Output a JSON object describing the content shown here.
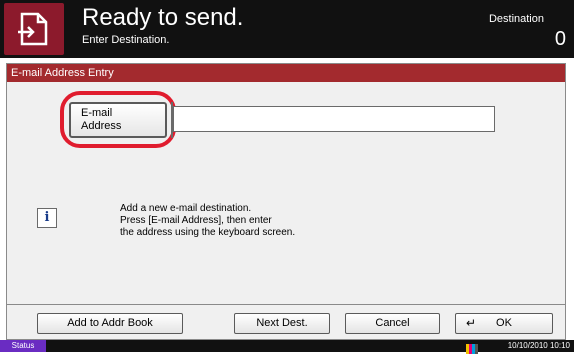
{
  "header": {
    "title": "Ready to send.",
    "subtitle": "Enter Destination.",
    "destination_label": "Destination",
    "destination_count": "0",
    "icon": "send-document-icon"
  },
  "panel": {
    "title": "E-mail Address Entry",
    "email_button_line1": "E-mail",
    "email_button_line2": "Address",
    "address_value": "",
    "info_icon": "info-icon",
    "info_lines": [
      "Add a new e-mail destination.",
      "Press [E-mail Address], then enter",
      "the address using the keyboard screen."
    ]
  },
  "buttons": {
    "add_to_addr_book": "Add to Addr Book",
    "next_dest": "Next Dest.",
    "cancel": "Cancel",
    "ok": "OK"
  },
  "status": {
    "label": "Status",
    "datetime": "10/10/2010  10:10",
    "toner_colors": [
      "#f2c200",
      "#e0007a",
      "#00a0e0",
      "#000000"
    ]
  },
  "colors": {
    "panel_title_bg": "#a32a2e",
    "highlight": "#e01c2e",
    "app_icon_bg": "#8c1a2c",
    "status_bg": "#6a2cc2"
  }
}
